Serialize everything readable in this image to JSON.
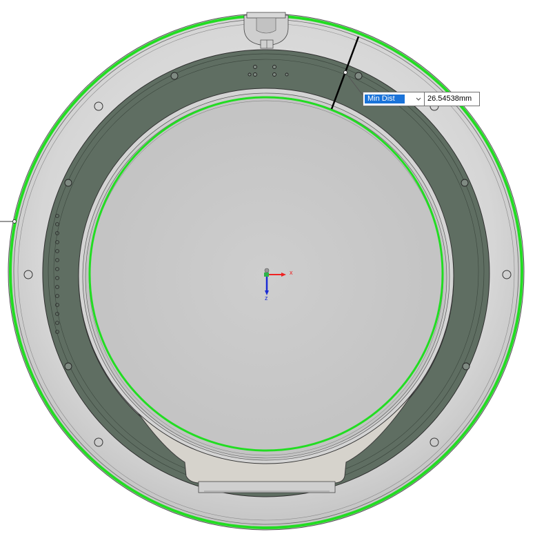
{
  "measure": {
    "select_value": "Min Dist",
    "distance": "26.54538mm"
  },
  "triad": {
    "x_label": "x",
    "z_label": "z"
  },
  "colors": {
    "background": "#ffffff",
    "outer_shell": "#dddddd",
    "flange": "#5f6e62",
    "inner_face": "#cbcbcb",
    "highlight": "#22dd22",
    "select_highlight": "#1a73d9"
  }
}
